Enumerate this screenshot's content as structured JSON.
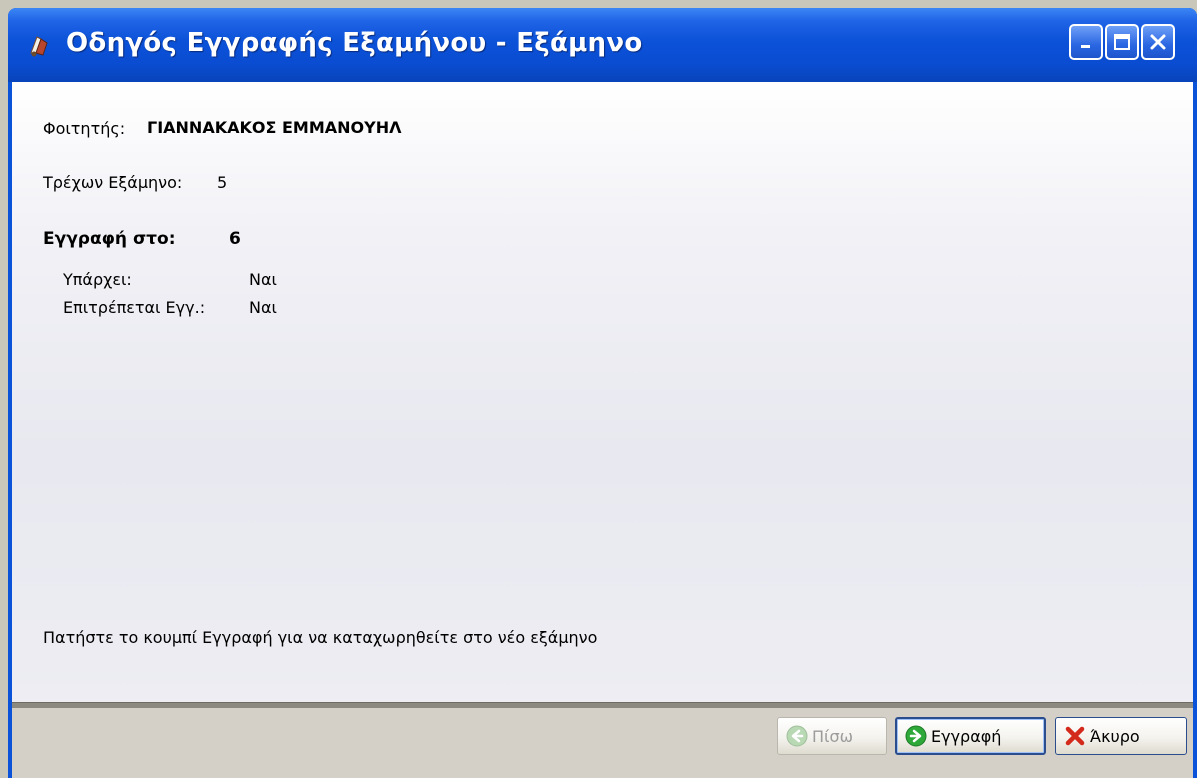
{
  "window": {
    "title": "Οδηγός Εγγραφής Εξαμήνου - Εξάμηνο",
    "icon": "app-icon",
    "controls": [
      "minimize-icon",
      "maximize-icon",
      "close-icon"
    ]
  },
  "student": {
    "label": "Φοιτητής:",
    "name": "ΓΙΑΝΝΑΚΑΚΟΣ ΕΜΜΑΝΟΥΗΛ"
  },
  "current_semester": {
    "label": "Τρέχων Εξάμηνο:",
    "value": "5"
  },
  "registration": {
    "label": "Εγγραφή στο:",
    "value": "6",
    "exists_label": "Υπάρχει:",
    "exists_value": "Ναι",
    "allowed_label": "Επιτρέπεται Εγγ.:",
    "allowed_value": "Ναι"
  },
  "instruction": "Πατήστε το κουμπί Εγγραφή για να καταχωρηθείτε στο νέο εξάμηνο",
  "buttons": {
    "back": "Πίσω",
    "register": "Εγγραφή",
    "cancel": "Άκυρο"
  },
  "colors": {
    "titlebar": "#0a52d8",
    "content_bg": "#eeeef4",
    "footer_bg": "#d4d0c8",
    "register_icon": "#2fa83a",
    "cancel_icon": "#d32a1c"
  }
}
